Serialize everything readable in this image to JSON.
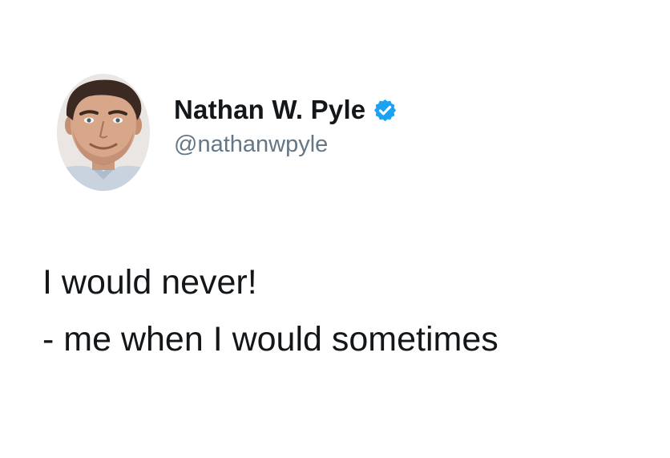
{
  "author": {
    "display_name": "Nathan W. Pyle",
    "handle": "@nathanwpyle",
    "verified": true,
    "verified_badge_color": "#1da1f2"
  },
  "avatar": {
    "icon": "profile-photo"
  },
  "tweet": {
    "lines": [
      "I would never!",
      "- me when I would sometimes"
    ]
  },
  "colors": {
    "name_text": "#14171a",
    "handle_text": "#657786",
    "body_text": "#14171a",
    "background": "#ffffff"
  }
}
